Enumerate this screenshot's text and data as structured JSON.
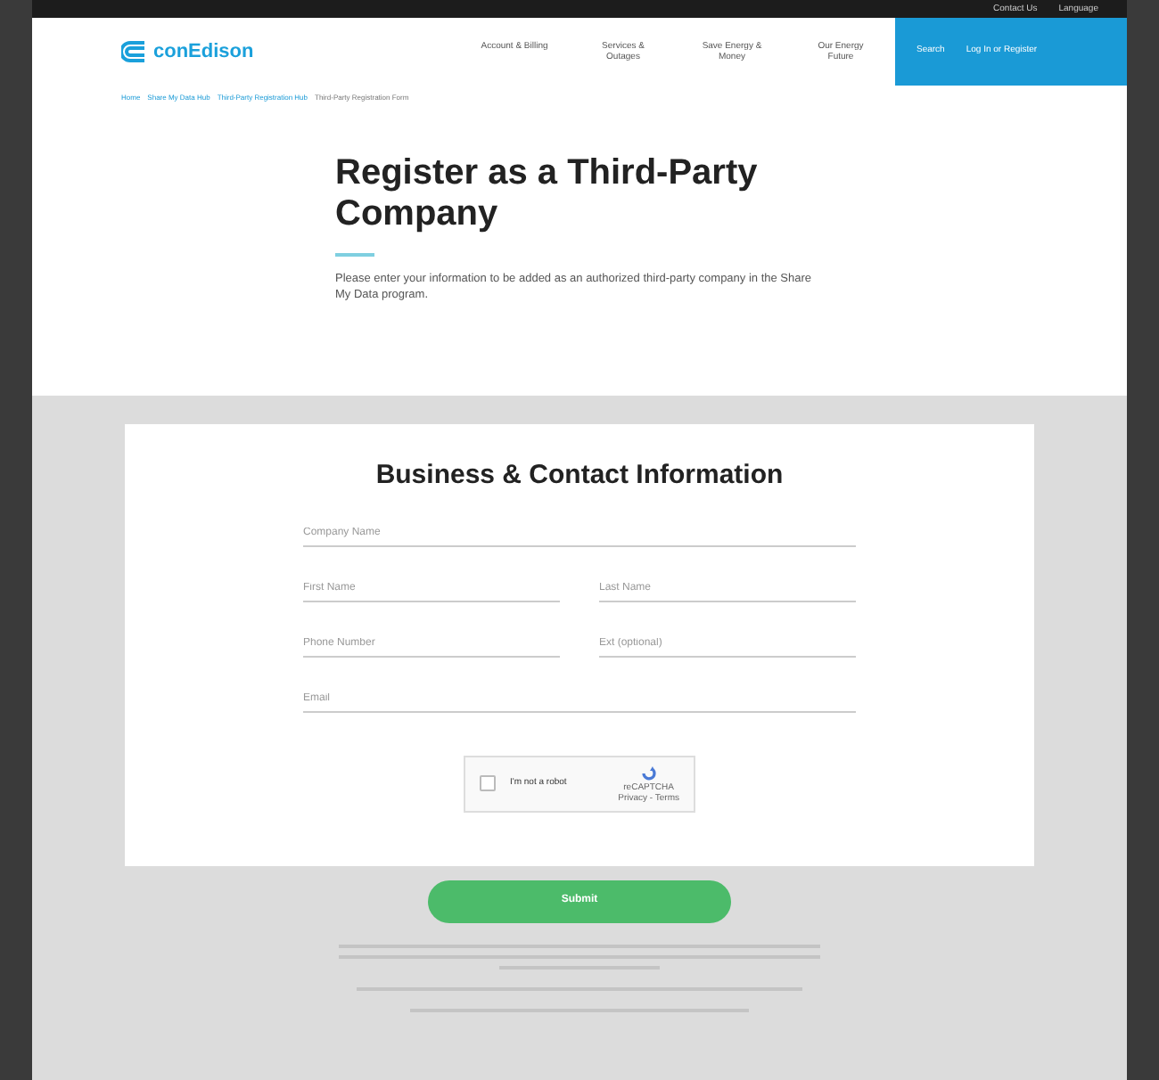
{
  "utility_links": [
    "Contact Us",
    "Language"
  ],
  "logo": "conEdison",
  "nav": [
    "Account & Billing",
    "Services & Outages",
    "Save Energy & Money",
    "Our Energy Future"
  ],
  "search": "Search",
  "login": "Log In or Register",
  "breadcrumb": [
    "Home",
    "Share My Data Hub",
    "Third-Party Registration Hub",
    "Third-Party Registration Form"
  ],
  "title": "Register as a Third-Party Company",
  "intro": "Please enter your information to be added as an authorized third-party company in the Share My Data program.",
  "form": {
    "heading": "Business & Contact Information",
    "rows": [
      [
        {
          "placeholder": "Company Name"
        }
      ],
      [
        {
          "placeholder": "First Name"
        },
        {
          "placeholder": "Last Name"
        }
      ],
      [
        {
          "placeholder": "Phone Number"
        },
        {
          "placeholder": "Ext (optional)"
        }
      ],
      [
        {
          "placeholder": "Email"
        }
      ]
    ],
    "captcha": {
      "label": "I'm not a robot",
      "checked": false,
      "brand": "reCAPTCHA",
      "links": "Privacy - Terms"
    }
  },
  "submit": "Submit"
}
